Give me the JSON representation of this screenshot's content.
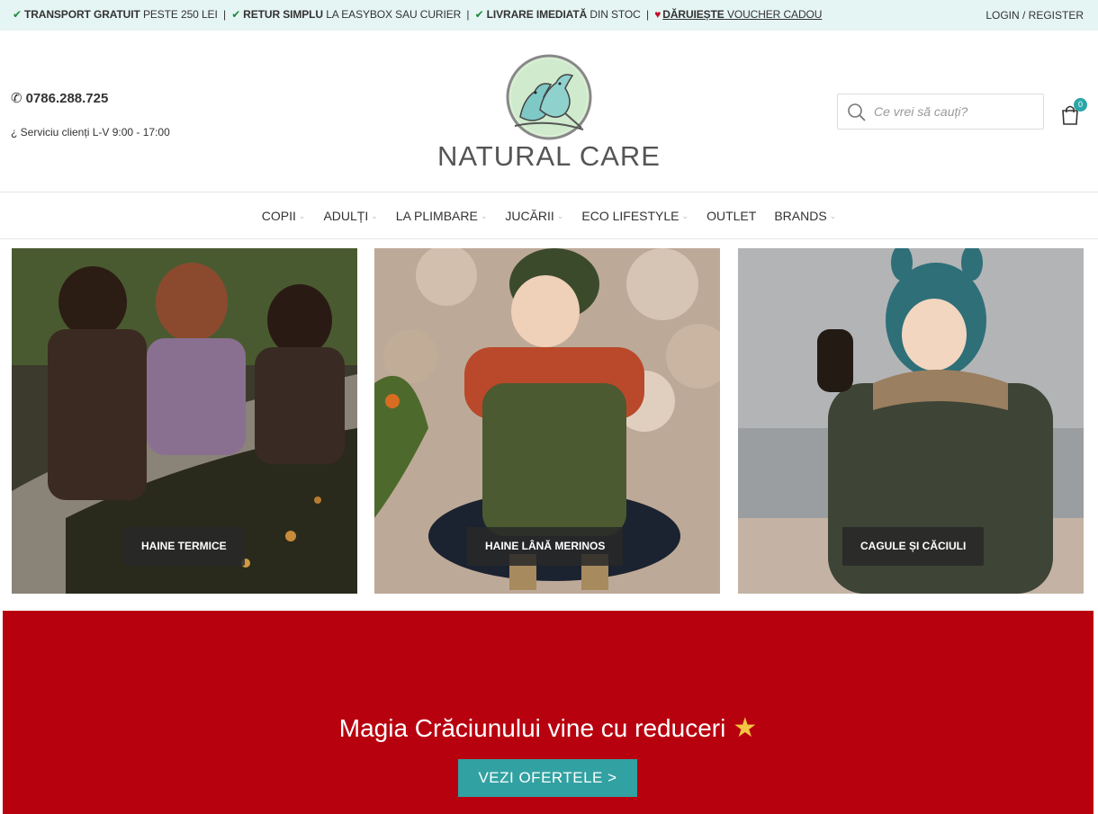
{
  "topbar": {
    "promos": [
      {
        "bold": "TRANSPORT GRATUIT",
        "rest": "PESTE 250 LEI"
      },
      {
        "bold": "RETUR SIMPLU",
        "rest": "LA EASYBOX SAU CURIER"
      },
      {
        "bold": "LIVRARE IMEDIATĂ",
        "rest": "DIN STOC"
      }
    ],
    "gift_bold": "DĂRUIEȘTE",
    "gift_rest": "VOUCHER CADOU",
    "separator": "|",
    "login": "LOGIN / REGISTER"
  },
  "header": {
    "phone": "0786.288.725",
    "hours": "¿ Serviciu clienți L-V 9:00 - 17:00",
    "logo_text": "NATURAL CARE",
    "search_placeholder": "Ce vrei să cauți?",
    "cart_count": "0"
  },
  "nav": {
    "items": [
      {
        "label": "COPII",
        "has_dropdown": true
      },
      {
        "label": "ADULȚI",
        "has_dropdown": true
      },
      {
        "label": "LA PLIMBARE",
        "has_dropdown": true
      },
      {
        "label": "JUCĂRII",
        "has_dropdown": true
      },
      {
        "label": "ECO LIFESTYLE",
        "has_dropdown": true
      },
      {
        "label": "OUTLET",
        "has_dropdown": false
      },
      {
        "label": "BRANDS",
        "has_dropdown": true
      }
    ]
  },
  "categories": [
    {
      "label": "HAINE TERMICE"
    },
    {
      "label": "HAINE LÂNĂ MERINOS"
    },
    {
      "label": "CAGULE ȘI CĂCIULI"
    }
  ],
  "banner": {
    "title": "Magia Crăciunului vine cu reduceri",
    "star": "★",
    "button": "VEZI OFERTELE >"
  },
  "colors": {
    "topbar_bg": "#e5f5f3",
    "accent": "#32a1a2",
    "banner_bg": "#b8010f"
  }
}
